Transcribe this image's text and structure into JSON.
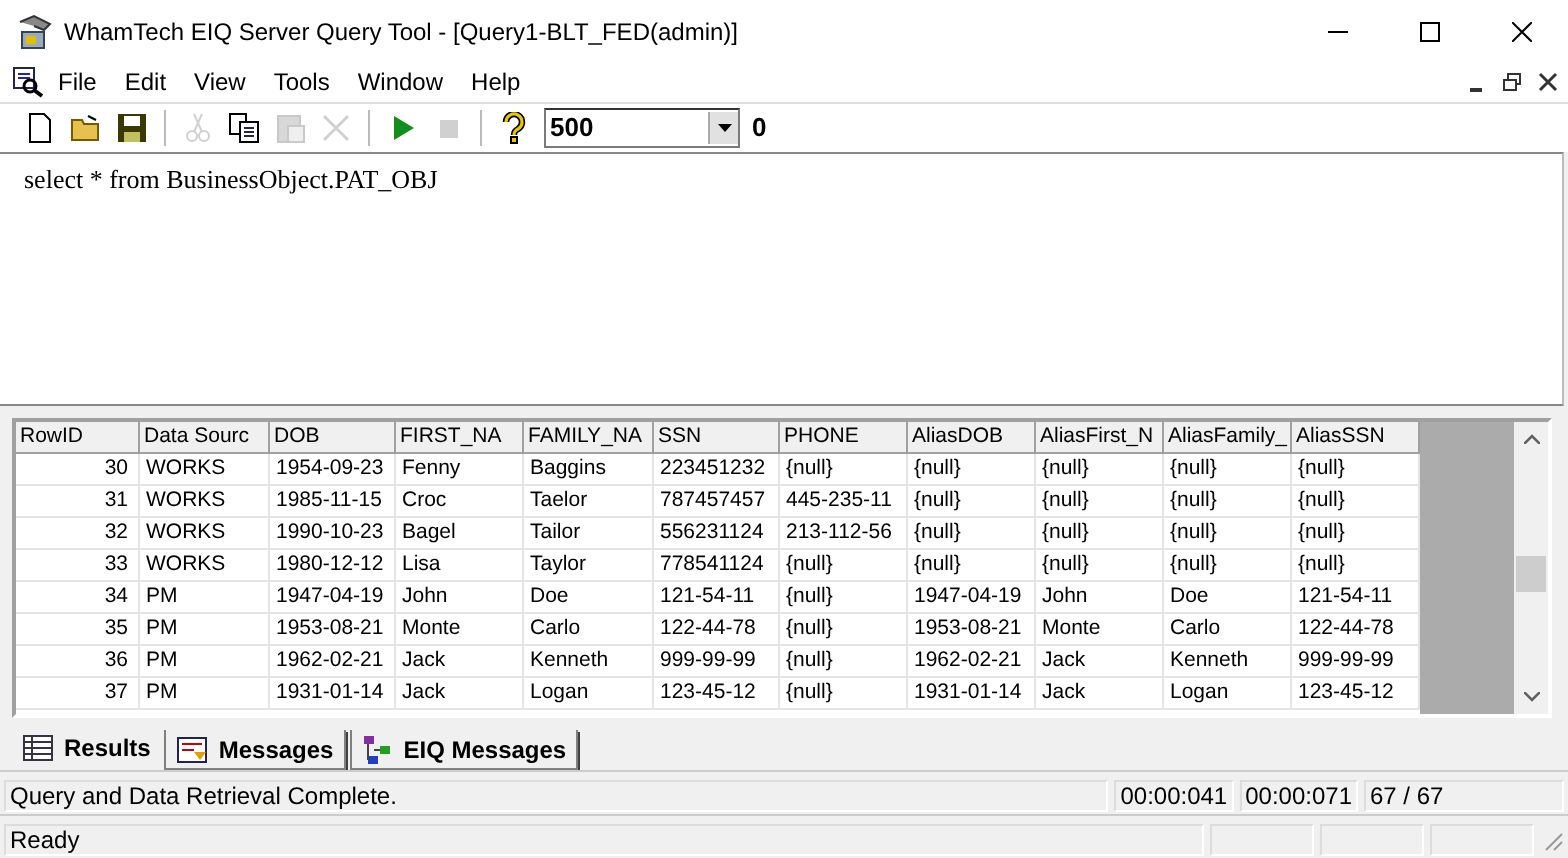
{
  "window": {
    "title": "WhamTech EIQ Server Query Tool - [Query1-BLT_FED(admin)]"
  },
  "menu": [
    "File",
    "Edit",
    "View",
    "Tools",
    "Window",
    "Help"
  ],
  "toolbar": {
    "buttons": [
      {
        "kind": "new",
        "disabled": false
      },
      {
        "kind": "open",
        "disabled": false
      },
      {
        "kind": "save",
        "disabled": false
      },
      {
        "kind": "sep"
      },
      {
        "kind": "cut",
        "disabled": true
      },
      {
        "kind": "copy",
        "disabled": false
      },
      {
        "kind": "paste",
        "disabled": true
      },
      {
        "kind": "delete",
        "disabled": true
      },
      {
        "kind": "sep"
      },
      {
        "kind": "run",
        "disabled": false
      },
      {
        "kind": "stop",
        "disabled": true
      },
      {
        "kind": "sep"
      },
      {
        "kind": "help",
        "disabled": false
      }
    ],
    "row_limit": "500",
    "count": "0"
  },
  "editor": {
    "query": "select * from BusinessObject.PAT_OBJ"
  },
  "grid": {
    "columns": [
      "RowID",
      "Data Sourc",
      "DOB",
      "FIRST_NA",
      "FAMILY_NA",
      "SSN",
      "PHONE",
      "AliasDOB",
      "AliasFirst_N",
      "AliasFamily_",
      "AliasSSN"
    ],
    "rows": [
      [
        "30",
        "WORKS",
        "1954-09-23",
        "Fenny",
        "Baggins",
        "223451232",
        "{null}",
        "{null}",
        "{null}",
        "{null}",
        "{null}"
      ],
      [
        "31",
        "WORKS",
        "1985-11-15",
        "Croc",
        "Taelor",
        "787457457",
        "445-235-11",
        "{null}",
        "{null}",
        "{null}",
        "{null}"
      ],
      [
        "32",
        "WORKS",
        "1990-10-23",
        "Bagel",
        "Tailor",
        "556231124",
        "213-112-56",
        "{null}",
        "{null}",
        "{null}",
        "{null}"
      ],
      [
        "33",
        "WORKS",
        "1980-12-12",
        "Lisa",
        "Taylor",
        "778541124",
        "{null}",
        "{null}",
        "{null}",
        "{null}",
        "{null}"
      ],
      [
        "34",
        "PM",
        "1947-04-19",
        "John",
        "Doe",
        "121-54-11",
        "{null}",
        "1947-04-19",
        "John",
        "Doe",
        "121-54-11"
      ],
      [
        "35",
        "PM",
        "1953-08-21",
        "Monte",
        "Carlo",
        "122-44-78",
        "{null}",
        "1953-08-21",
        "Monte",
        "Carlo",
        "122-44-78"
      ],
      [
        "36",
        "PM",
        "1962-02-21",
        "Jack",
        "Kenneth",
        "999-99-99",
        "{null}",
        "1962-02-21",
        "Jack",
        "Kenneth",
        "999-99-99"
      ],
      [
        "37",
        "PM",
        "1931-01-14",
        "Jack",
        "Logan",
        "123-45-12",
        "{null}",
        "1931-01-14",
        "Jack",
        "Logan",
        "123-45-12"
      ]
    ]
  },
  "tabs": [
    {
      "label": "Results",
      "kind": "grid",
      "selected": true
    },
    {
      "label": "Messages",
      "kind": "messages",
      "selected": false
    },
    {
      "label": "EIQ Messages",
      "kind": "eiq",
      "selected": false
    }
  ],
  "status_bar": {
    "message": "Query and Data Retrieval Complete.",
    "elapsed_1": "00:00:041",
    "elapsed_2": "00:00:071",
    "rows": "67 / 67",
    "state": "Ready"
  }
}
